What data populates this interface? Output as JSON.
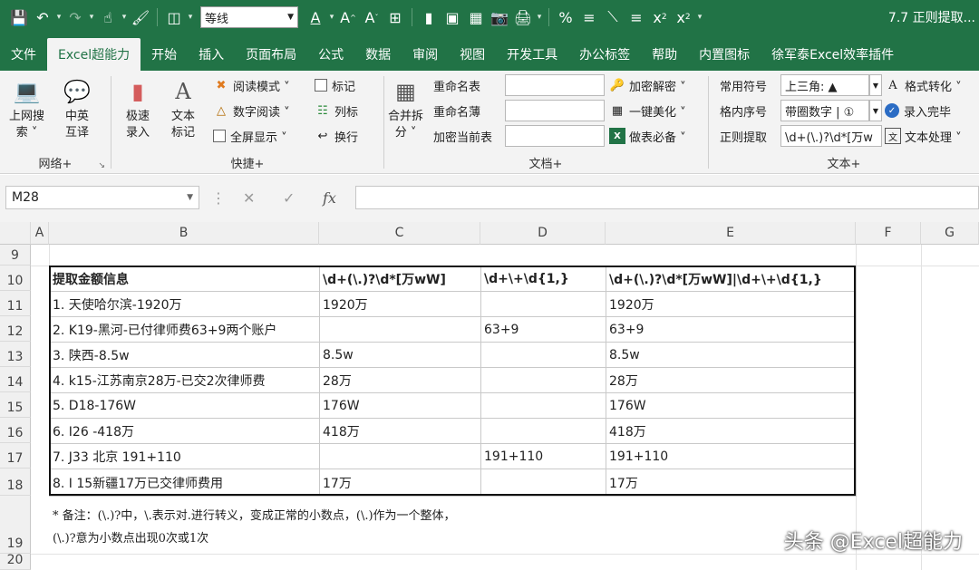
{
  "qat": {
    "font_name": "等线",
    "title": "7.7 正则提取..."
  },
  "tabs": [
    "文件",
    "Excel超能力",
    "开始",
    "插入",
    "页面布局",
    "公式",
    "数据",
    "审阅",
    "视图",
    "开发工具",
    "办公标签",
    "帮助",
    "内置图标",
    "徐军泰Excel效率插件"
  ],
  "ribbon": {
    "network": {
      "label": "网络+",
      "btn1_l1": "上网搜",
      "btn1_l2": "索 ˅",
      "btn2_l1": "中英",
      "btn2_l2": "互译"
    },
    "quick": {
      "label": "快捷+",
      "btn1_l1": "极速",
      "btn1_l2": "录入",
      "btn2_l1": "文本",
      "btn2_l2": "标记",
      "read_mode": "阅读模式 ˅",
      "digit_read": "数字阅读 ˅",
      "fullscreen": "全屏显示 ˅",
      "mark": "标记",
      "col_mark": "列标",
      "wrap": "换行"
    },
    "doc": {
      "label": "文档+",
      "merge_l1": "合并拆",
      "merge_l2": "分 ˅",
      "rename_sheet": "重命名表",
      "rename_book": "重命名薄",
      "encrypt_sheet": "加密当前表",
      "decrypt": "加密解密 ˅",
      "beautify": "一键美化 ˅",
      "essential": "做表必备 ˅"
    },
    "text": {
      "label": "文本+",
      "common_symbol": "常用符号",
      "common_symbol_value": "上三角: ▲",
      "seq_number": "格内序号",
      "seq_number_value": "带圈数字 | ①",
      "regex": "正则提取",
      "regex_value": "\\d+(\\.)?\\d*[万w",
      "format_convert": "格式转化 ˅",
      "enter_done": "录入完毕",
      "text_process": "文本处理 ˅"
    }
  },
  "formula_bar": {
    "name_box": "M28",
    "fx": "fx"
  },
  "columns": [
    "A",
    "B",
    "C",
    "D",
    "E",
    "F",
    "G"
  ],
  "rows": [
    "9",
    "10",
    "11",
    "12",
    "13",
    "14",
    "15",
    "16",
    "17",
    "18",
    "19",
    "20"
  ],
  "table": {
    "headers": [
      "提取金额信息",
      "\\d+(\\.)?\\d*[万wW]",
      "\\d+\\+\\d{1,}",
      "\\d+(\\.)?\\d*[万wW]|\\d+\\+\\d{1,}"
    ],
    "rows": [
      [
        "1. 天使哈尔滨-1920万",
        "1920万",
        "",
        "1920万"
      ],
      [
        "2. K19-黑河-已付律师费63+9两个账户",
        "",
        "63+9",
        "63+9"
      ],
      [
        "3. 陕西-8.5w",
        "8.5w",
        "",
        "8.5w"
      ],
      [
        "4. k15-江苏南京28万-已交2次律师费",
        "28万",
        "",
        "28万"
      ],
      [
        "5. D18-176W",
        "176W",
        "",
        "176W"
      ],
      [
        "6. I26 -418万",
        "418万",
        "",
        "418万"
      ],
      [
        "7. J33 北京 191+110",
        "",
        "191+110",
        "191+110"
      ],
      [
        "8. I 15新疆17万已交律师费用",
        "17万",
        "",
        "17万"
      ]
    ]
  },
  "note": {
    "line1": "* 备注：(\\.)?中，\\.表示对.进行转义，变成正常的小数点，(\\.)作为一个整体，",
    "line2": "(\\.)?意为小数点出现0次或1次"
  },
  "watermark": "头条 @Excel超能力",
  "colors": {
    "excel_green": "#217346",
    "ribbon_bg": "#f3f3f3"
  }
}
